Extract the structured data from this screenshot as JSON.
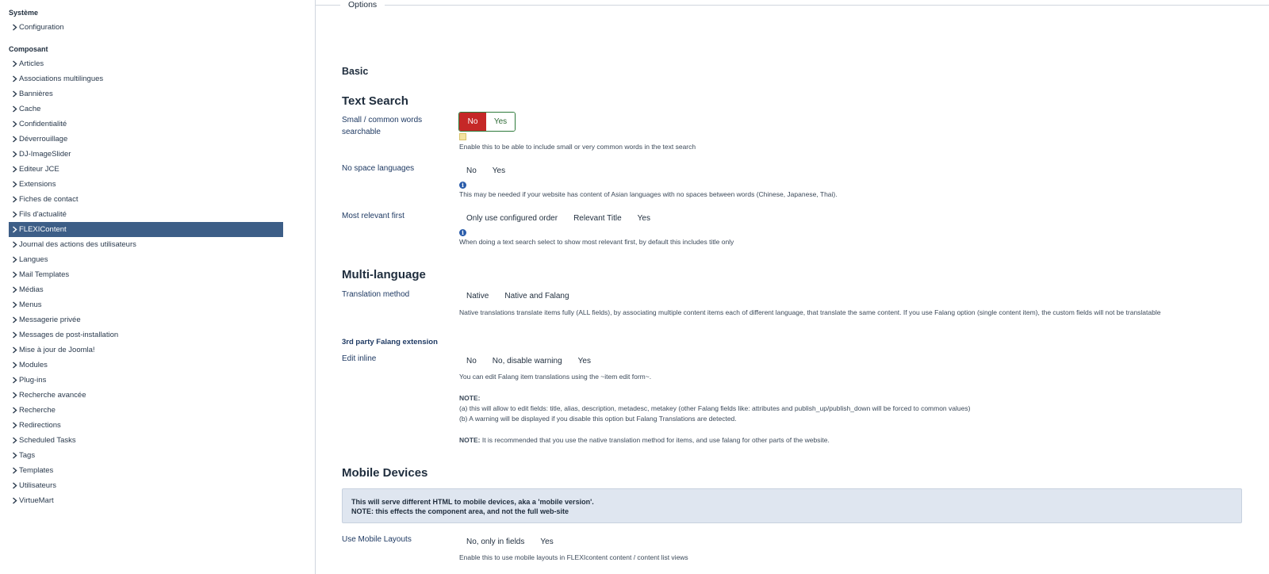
{
  "sidebar": {
    "heading_system": "Système",
    "item_configuration": "Configuration",
    "heading_component": "Composant",
    "items": [
      "Articles",
      "Associations multilingues",
      "Bannières",
      "Cache",
      "Confidentialité",
      "Déverrouillage",
      "DJ-ImageSlider",
      "Editeur JCE",
      "Extensions",
      "Fiches de contact",
      "Fils d'actualité",
      "FLEXIContent",
      "Journal des actions des utilisateurs",
      "Langues",
      "Mail Templates",
      "Médias",
      "Menus",
      "Messagerie privée",
      "Messages de post-installation",
      "Mise à jour de Joomla!",
      "Modules",
      "Plug-ins",
      "Recherche avancée",
      "Recherche",
      "Redirections",
      "Scheduled Tasks",
      "Tags",
      "Templates",
      "Utilisateurs",
      "VirtueMart"
    ],
    "active_item": "FLEXIContent"
  },
  "main": {
    "legend": "Options",
    "basic_heading": "Basic",
    "text_search": {
      "heading": "Text Search",
      "small_words": {
        "label": "Small / common words searchable",
        "options": [
          "No",
          "Yes"
        ],
        "selected": "No",
        "description": "Enable this to be able to include small or very common words in the text search"
      },
      "no_space": {
        "label": "No space languages",
        "options": [
          "No",
          "Yes"
        ],
        "description": "This may be needed if your website has content of Asian languages with no spaces between words (Chinese, Japanese, Thai)."
      },
      "most_relevant": {
        "label": "Most relevant first",
        "options": [
          "Only use configured order",
          "Relevant Title",
          "Yes"
        ],
        "description": "When doing a text search select to show most relevant first, by default this includes title only"
      }
    },
    "multi_language": {
      "heading": "Multi-language",
      "translation_method": {
        "label": "Translation method",
        "options": [
          "Native",
          "Native and Falang"
        ],
        "description": "Native translations translate items fully (ALL fields), by associating multiple content items each of different language, that translate the same content. If you use Falang option (single content item), the custom fields will not be translatable"
      },
      "falang_heading": "3rd party Falang extension",
      "edit_inline": {
        "label": "Edit inline",
        "options": [
          "No",
          "No, disable warning",
          "Yes"
        ],
        "description": "You can edit Falang item translations using the ~item edit form~.",
        "note_label": "NOTE:",
        "note_a": "(a) this will allow to edit fields: title, alias, description, metadesc, metakey (other Falang fields like: attributes and publish_up/publish_down will be forced to common values)",
        "note_b": "(b) A warning will be displayed if you disable this option but Falang Translations are detected.",
        "note2_label": "NOTE:",
        "note2_text": "It is recommended that you use the native translation method for items, and use falang for other parts of the website."
      }
    },
    "mobile": {
      "heading": "Mobile Devices",
      "alert_line1": "This will serve different HTML to mobile devices, aka a 'mobile version'.",
      "alert_line2": "NOTE: this effects the component area, and not the full web-site",
      "use_layouts": {
        "label": "Use Mobile Layouts",
        "options": [
          "No, only in fields",
          "Yes"
        ],
        "description": "Enable this to use mobile layouts in FLEXIcontent content / content list views"
      }
    }
  },
  "colors": {
    "active_bg": "#3d5e87",
    "toggle_no": "#c52827",
    "toggle_border": "#2d7a3a",
    "alert_bg": "#dfe6f0"
  }
}
